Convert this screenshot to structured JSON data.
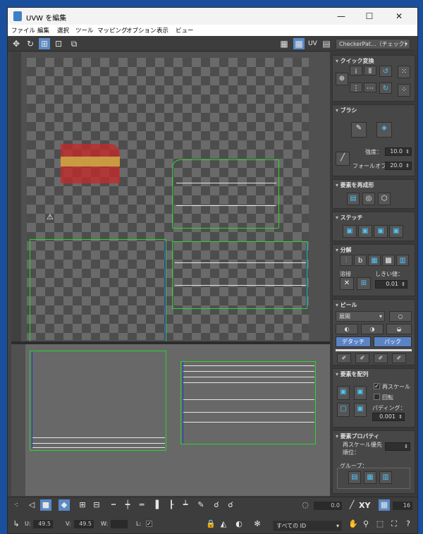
{
  "window": {
    "title": "UVW を編集",
    "min": "—",
    "max": "☐",
    "close": "✕"
  },
  "menu": [
    "ファイル",
    "編集",
    "選択",
    "ツール",
    "マッピング",
    "オプション",
    "表示",
    "ビュー"
  ],
  "toolbar": {
    "uv_label": "UV",
    "texture_select": "CheckerPat...（チェック）",
    "icons": [
      "move-icon",
      "rotate-icon",
      "scale-icon",
      "freeform-icon",
      "mirror-icon"
    ]
  },
  "panel": {
    "quick_transform": {
      "title": "クイック変換"
    },
    "brush": {
      "title": "ブラシ",
      "strength_label": "強度：",
      "strength_value": "10.0",
      "falloff_label": "フォールオフ：",
      "falloff_value": "20.0"
    },
    "reshape": {
      "title": "要素を再成形"
    },
    "stitch": {
      "title": "ステッチ"
    },
    "explode": {
      "title": "分解",
      "weld_label": "溶接",
      "threshold_label": "しきい値：",
      "threshold_value": "0.01"
    },
    "peel": {
      "title": "ピール",
      "mode_select": "展開",
      "detach_label": "デタッチ",
      "pack_label": "パック"
    },
    "arrange": {
      "title": "要素を配列",
      "rescale_label": "再スケール",
      "rotate_label": "回転",
      "padding_label": "パディング：",
      "padding_value": "0.001"
    },
    "properties": {
      "title": "要素プロパティ",
      "rescale_priority_label": "再スケール優先順位：",
      "group_label": "グループ："
    }
  },
  "status": {
    "u_label": "U:",
    "u_value": "49.5",
    "v_label": "V:",
    "v_value": "49.5",
    "w_label": "W:",
    "w_value": "",
    "l_label": "L:",
    "angle_value": "0.0",
    "xy_label": "XY",
    "grid_value": "16",
    "id_select": "すべての ID"
  }
}
